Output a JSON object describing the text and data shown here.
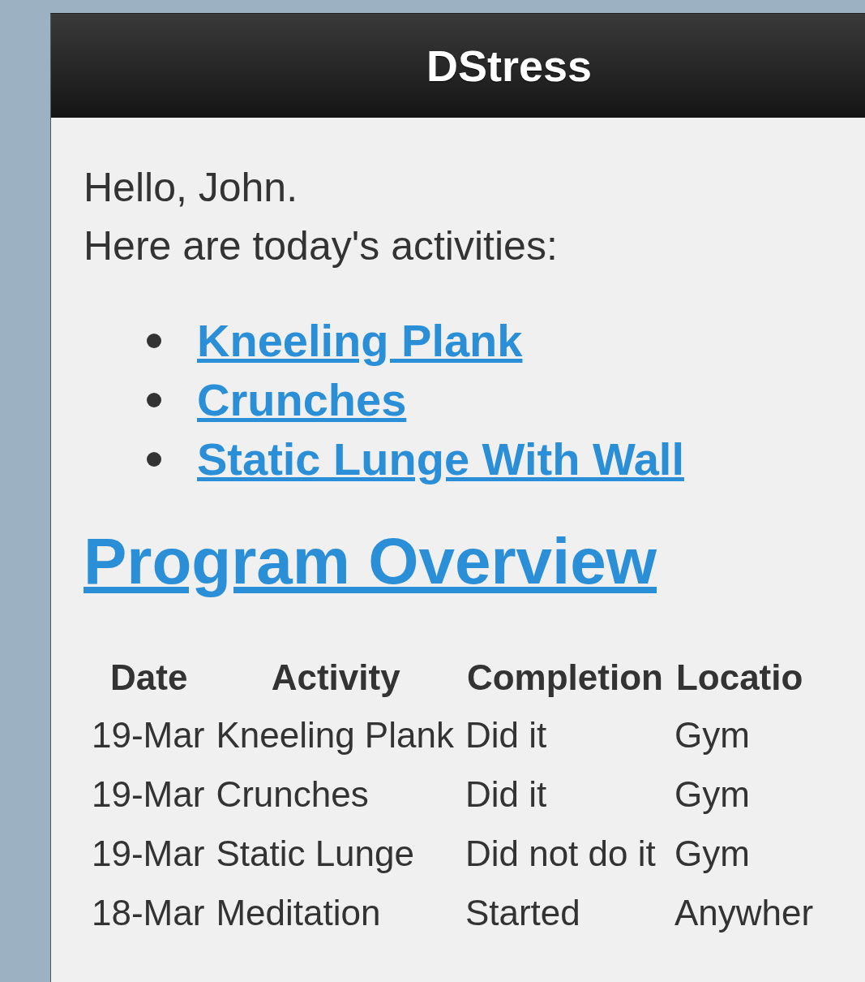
{
  "header": {
    "title": "DStress"
  },
  "greeting": {
    "lines": [
      "Hello, John.",
      "Here are today's activities:"
    ]
  },
  "activities": [
    {
      "label": "Kneeling Plank"
    },
    {
      "label": "Crunches"
    },
    {
      "label": "Static Lunge With Wall"
    }
  ],
  "overview": {
    "title": "Program Overview"
  },
  "table": {
    "columns": [
      "Date",
      "Activity",
      "Completion",
      "Locatio"
    ],
    "rows": [
      [
        "19-Mar",
        "Kneeling Plank",
        "Did it",
        "Gym"
      ],
      [
        "19-Mar",
        "Crunches",
        "Did it",
        "Gym"
      ],
      [
        "19-Mar",
        "Static Lunge",
        "Did not do it",
        "Gym"
      ],
      [
        "18-Mar",
        "Meditation",
        "Started",
        "Anywher"
      ]
    ]
  }
}
